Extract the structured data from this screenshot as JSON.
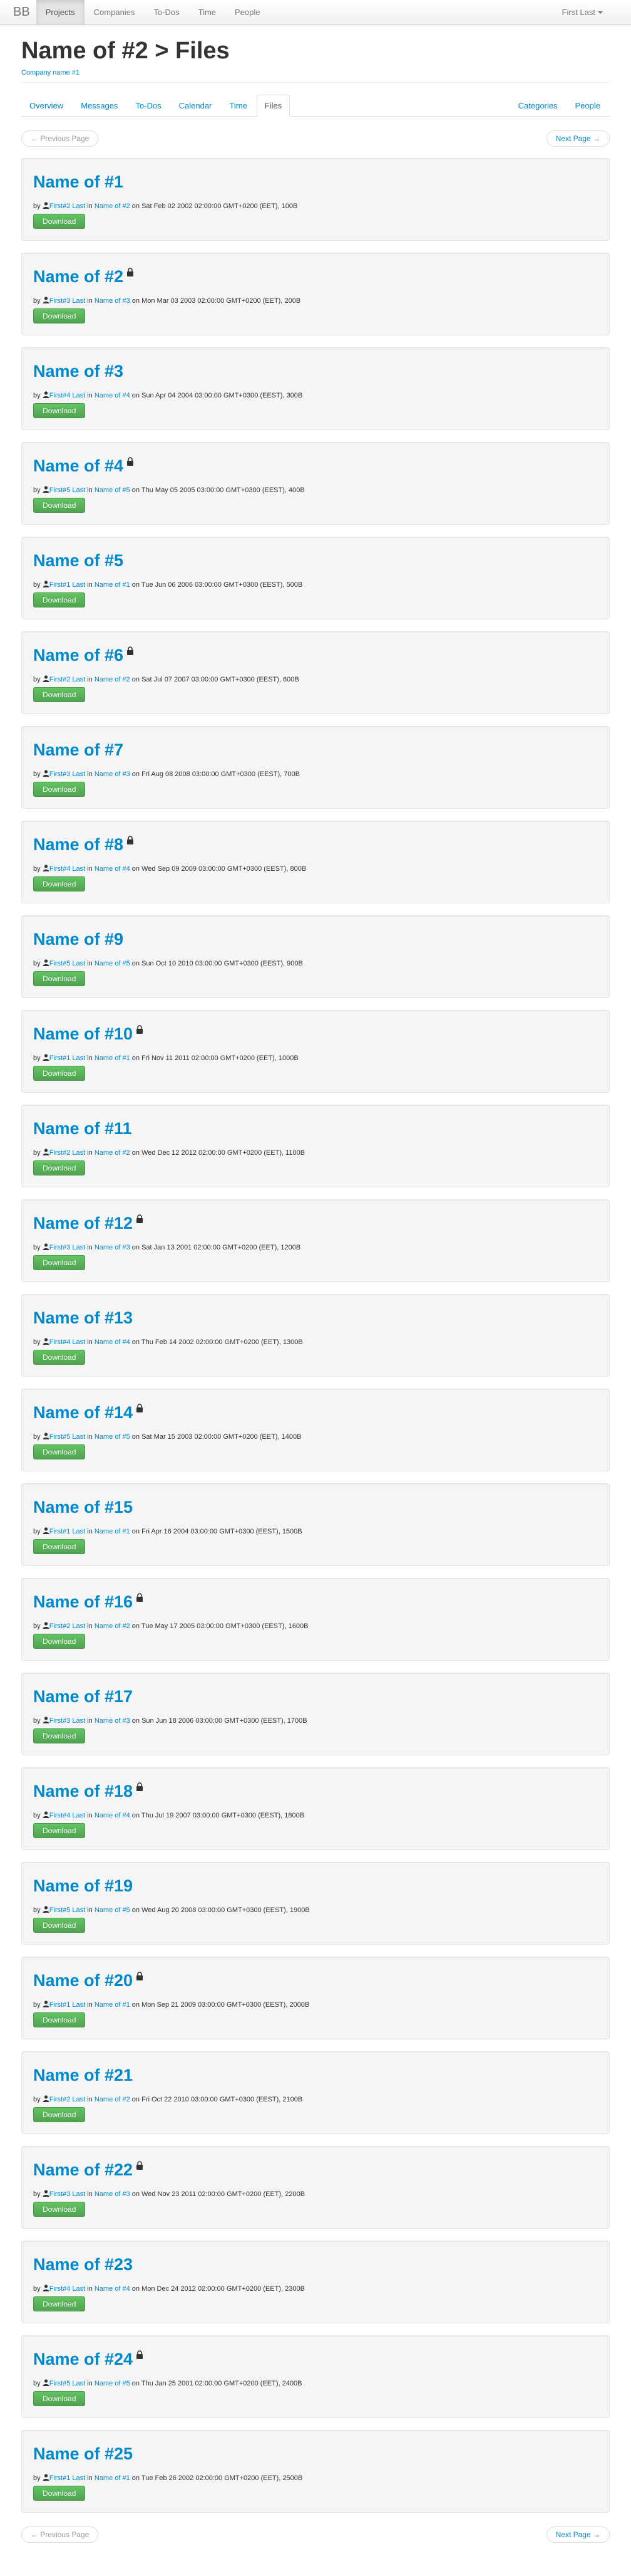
{
  "navbar": {
    "brand": "BB",
    "items": [
      {
        "label": "Projects",
        "active": true
      },
      {
        "label": "Companies",
        "active": false
      },
      {
        "label": "To-Dos",
        "active": false
      },
      {
        "label": "Time",
        "active": false
      },
      {
        "label": "People",
        "active": false
      }
    ],
    "user_label": "First Last"
  },
  "header": {
    "title": "Name of #2 > Files",
    "company_link": "Company name #1"
  },
  "tabs": {
    "left": [
      {
        "label": "Overview",
        "active": false
      },
      {
        "label": "Messages",
        "active": false
      },
      {
        "label": "To-Dos",
        "active": false
      },
      {
        "label": "Calendar",
        "active": false
      },
      {
        "label": "Time",
        "active": false
      },
      {
        "label": "Files",
        "active": true
      }
    ],
    "right": [
      {
        "label": "Categories"
      },
      {
        "label": "People"
      }
    ]
  },
  "pager": {
    "previous": "← Previous Page",
    "next": "Next Page →"
  },
  "labels": {
    "by": "by",
    "in": "in",
    "on": "on",
    "download": "Download"
  },
  "files": [
    {
      "name": "Name of #1",
      "locked": false,
      "author": "First#2 Last",
      "project": "Name of #2",
      "date": "Sat Feb 02 2002 02:00:00 GMT+0200 (EET)",
      "size": "100B"
    },
    {
      "name": "Name of #2",
      "locked": true,
      "author": "First#3 Last",
      "project": "Name of #3",
      "date": "Mon Mar 03 2003 02:00:00 GMT+0200 (EET)",
      "size": "200B"
    },
    {
      "name": "Name of #3",
      "locked": false,
      "author": "First#4 Last",
      "project": "Name of #4",
      "date": "Sun Apr 04 2004 03:00:00 GMT+0300 (EEST)",
      "size": "300B"
    },
    {
      "name": "Name of #4",
      "locked": true,
      "author": "First#5 Last",
      "project": "Name of #5",
      "date": "Thu May 05 2005 03:00:00 GMT+0300 (EEST)",
      "size": "400B"
    },
    {
      "name": "Name of #5",
      "locked": false,
      "author": "First#1 Last",
      "project": "Name of #1",
      "date": "Tue Jun 06 2006 03:00:00 GMT+0300 (EEST)",
      "size": "500B"
    },
    {
      "name": "Name of #6",
      "locked": true,
      "author": "First#2 Last",
      "project": "Name of #2",
      "date": "Sat Jul 07 2007 03:00:00 GMT+0300 (EEST)",
      "size": "600B"
    },
    {
      "name": "Name of #7",
      "locked": false,
      "author": "First#3 Last",
      "project": "Name of #3",
      "date": "Fri Aug 08 2008 03:00:00 GMT+0300 (EEST)",
      "size": "700B"
    },
    {
      "name": "Name of #8",
      "locked": true,
      "author": "First#4 Last",
      "project": "Name of #4",
      "date": "Wed Sep 09 2009 03:00:00 GMT+0300 (EEST)",
      "size": "800B"
    },
    {
      "name": "Name of #9",
      "locked": false,
      "author": "First#5 Last",
      "project": "Name of #5",
      "date": "Sun Oct 10 2010 03:00:00 GMT+0300 (EEST)",
      "size": "900B"
    },
    {
      "name": "Name of #10",
      "locked": true,
      "author": "First#1 Last",
      "project": "Name of #1",
      "date": "Fri Nov 11 2011 02:00:00 GMT+0200 (EET)",
      "size": "1000B"
    },
    {
      "name": "Name of #11",
      "locked": false,
      "author": "First#2 Last",
      "project": "Name of #2",
      "date": "Wed Dec 12 2012 02:00:00 GMT+0200 (EET)",
      "size": "1100B"
    },
    {
      "name": "Name of #12",
      "locked": true,
      "author": "First#3 Last",
      "project": "Name of #3",
      "date": "Sat Jan 13 2001 02:00:00 GMT+0200 (EET)",
      "size": "1200B"
    },
    {
      "name": "Name of #13",
      "locked": false,
      "author": "First#4 Last",
      "project": "Name of #4",
      "date": "Thu Feb 14 2002 02:00:00 GMT+0200 (EET)",
      "size": "1300B"
    },
    {
      "name": "Name of #14",
      "locked": true,
      "author": "First#5 Last",
      "project": "Name of #5",
      "date": "Sat Mar 15 2003 02:00:00 GMT+0200 (EET)",
      "size": "1400B"
    },
    {
      "name": "Name of #15",
      "locked": false,
      "author": "First#1 Last",
      "project": "Name of #1",
      "date": "Fri Apr 16 2004 03:00:00 GMT+0300 (EEST)",
      "size": "1500B"
    },
    {
      "name": "Name of #16",
      "locked": true,
      "author": "First#2 Last",
      "project": "Name of #2",
      "date": "Tue May 17 2005 03:00:00 GMT+0300 (EEST)",
      "size": "1600B"
    },
    {
      "name": "Name of #17",
      "locked": false,
      "author": "First#3 Last",
      "project": "Name of #3",
      "date": "Sun Jun 18 2006 03:00:00 GMT+0300 (EEST)",
      "size": "1700B"
    },
    {
      "name": "Name of #18",
      "locked": true,
      "author": "First#4 Last",
      "project": "Name of #4",
      "date": "Thu Jul 19 2007 03:00:00 GMT+0300 (EEST)",
      "size": "1800B"
    },
    {
      "name": "Name of #19",
      "locked": false,
      "author": "First#5 Last",
      "project": "Name of #5",
      "date": "Wed Aug 20 2008 03:00:00 GMT+0300 (EEST)",
      "size": "1900B"
    },
    {
      "name": "Name of #20",
      "locked": true,
      "author": "First#1 Last",
      "project": "Name of #1",
      "date": "Mon Sep 21 2009 03:00:00 GMT+0300 (EEST)",
      "size": "2000B"
    },
    {
      "name": "Name of #21",
      "locked": false,
      "author": "First#2 Last",
      "project": "Name of #2",
      "date": "Fri Oct 22 2010 03:00:00 GMT+0300 (EEST)",
      "size": "2100B"
    },
    {
      "name": "Name of #22",
      "locked": true,
      "author": "First#3 Last",
      "project": "Name of #3",
      "date": "Wed Nov 23 2011 02:00:00 GMT+0200 (EET)",
      "size": "2200B"
    },
    {
      "name": "Name of #23",
      "locked": false,
      "author": "First#4 Last",
      "project": "Name of #4",
      "date": "Mon Dec 24 2012 02:00:00 GMT+0200 (EET)",
      "size": "2300B"
    },
    {
      "name": "Name of #24",
      "locked": true,
      "author": "First#5 Last",
      "project": "Name of #5",
      "date": "Thu Jan 25 2001 02:00:00 GMT+0200 (EET)",
      "size": "2400B"
    },
    {
      "name": "Name of #25",
      "locked": false,
      "author": "First#1 Last",
      "project": "Name of #1",
      "date": "Tue Feb 26 2002 02:00:00 GMT+0200 (EET)",
      "size": "2500B"
    }
  ]
}
